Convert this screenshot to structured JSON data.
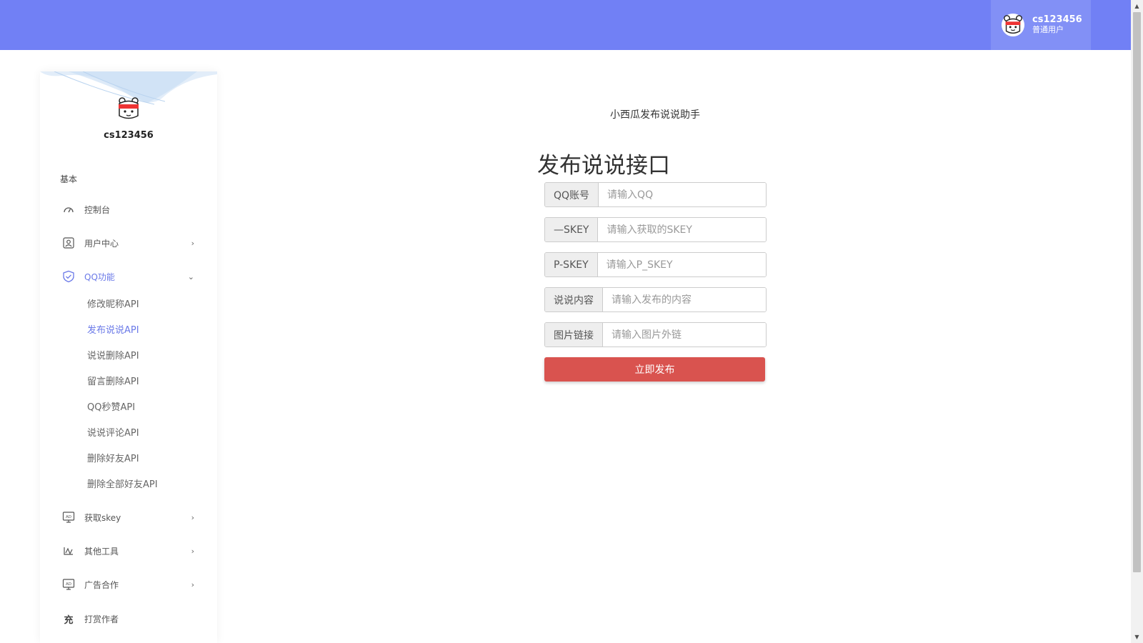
{
  "header": {
    "user_name": "cs123456",
    "user_role": "普通用户",
    "accent_color": "#7180f5"
  },
  "sidebar": {
    "profile_name": "cs123456",
    "section_label": "基本",
    "items": [
      {
        "label": "控制台",
        "icon": "gauge-icon"
      },
      {
        "label": "用户中心",
        "icon": "user-card-icon",
        "chevron": "›"
      },
      {
        "label": "QQ功能",
        "icon": "shield-icon",
        "chevron": "⌄"
      },
      {
        "label": "获取skey",
        "icon": "ad-monitor-icon",
        "chevron": "›"
      },
      {
        "label": "其他工具",
        "icon": "chart-line-icon",
        "chevron": "›"
      },
      {
        "label": "广告合作",
        "icon": "ad-monitor-icon",
        "chevron": "›"
      },
      {
        "label": "打赏作者",
        "icon": "charge-icon",
        "icon_text": "充"
      }
    ],
    "qq_subitems": [
      "修改昵称API",
      "发布说说API",
      "说说删除API",
      "留言删除API",
      "QQ秒赞API",
      "说说评论API",
      "删除好友API",
      "删除全部好友API"
    ],
    "active_subitem": "发布说说API"
  },
  "main": {
    "app_title": "小西瓜发布说说助手",
    "heading": "发布说说接口",
    "fields": [
      {
        "label": "QQ账号",
        "placeholder": "请输入QQ",
        "value": ""
      },
      {
        "label": "—SKEY",
        "placeholder": "请输入获取的SKEY",
        "value": ""
      },
      {
        "label": "P-SKEY",
        "placeholder": "请输入P_SKEY",
        "value": ""
      },
      {
        "label": "说说内容",
        "placeholder": "请输入发布的内容",
        "value": ""
      },
      {
        "label": "图片链接",
        "placeholder": "请输入图片外链",
        "value": ""
      }
    ],
    "submit_label": "立即发布",
    "submit_color": "#d9534f"
  }
}
